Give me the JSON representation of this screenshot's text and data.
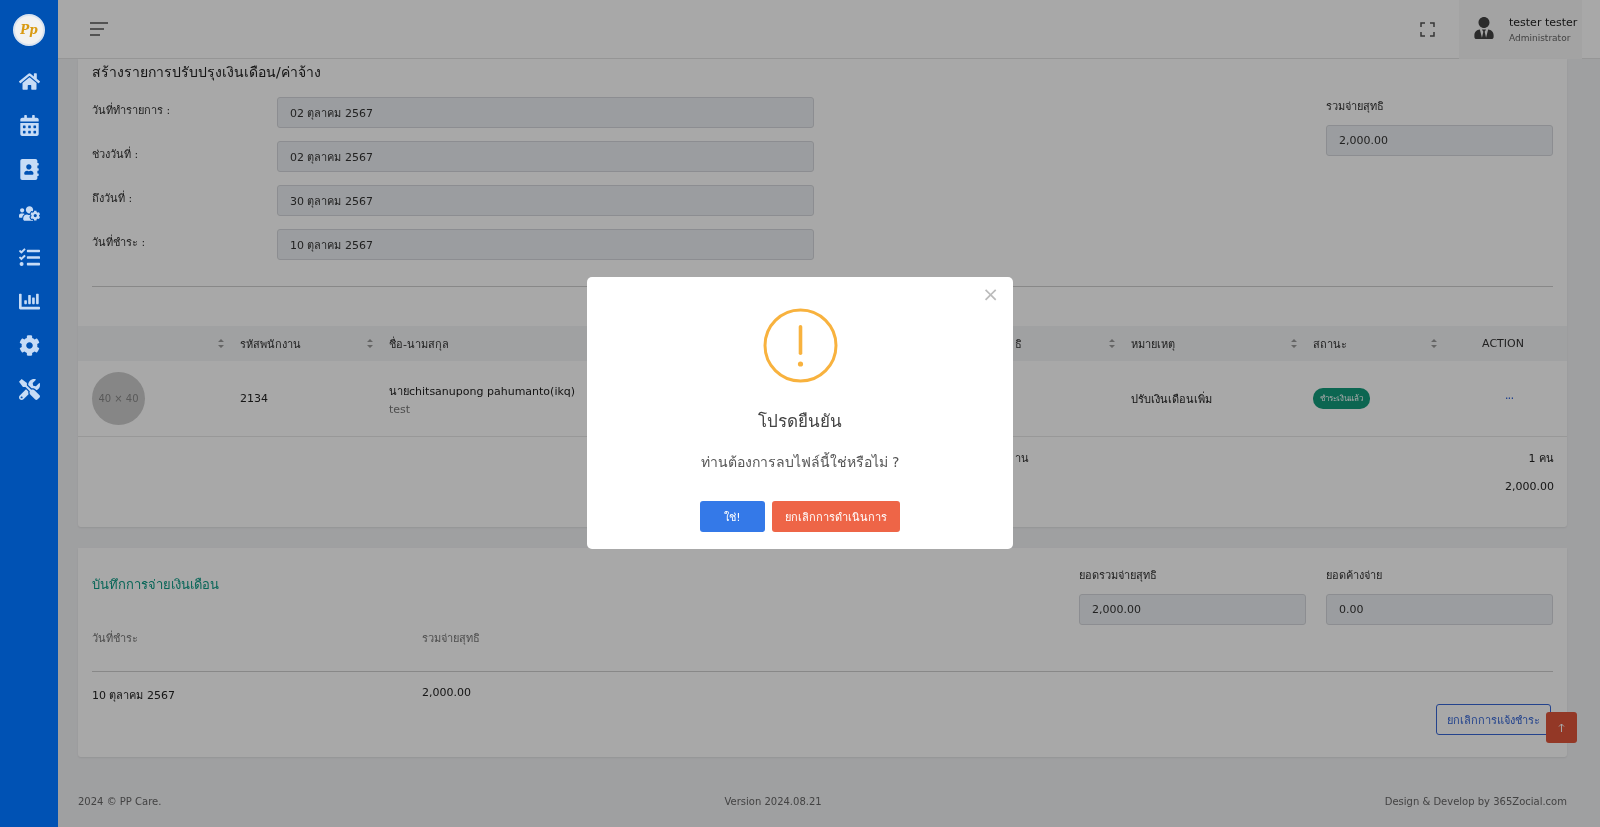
{
  "app": {
    "logo": "Pp"
  },
  "header": {
    "user": {
      "name": "tester tester",
      "role": "Administrator"
    }
  },
  "form": {
    "title": "สร้างรายการปรับปรุงเงินเดือน/ค่าจ้าง",
    "fields": [
      {
        "label": "วันที่ทำรายการ :",
        "value": "02 ตุลาคม 2567"
      },
      {
        "label": "ช่วงวันที่ :",
        "value": "02 ตุลาคม 2567"
      },
      {
        "label": "ถึงวันที่ :",
        "value": "30 ตุลาคม 2567"
      },
      {
        "label": "วันที่ชำระ :",
        "value": "10 ตุลาคม 2567"
      }
    ],
    "total": {
      "label": "รวมจ่ายสุทธิ",
      "value": "2,000.00"
    }
  },
  "table": {
    "columns": [
      {
        "sortable": true
      },
      {
        "label": "รหัสพนักงาน",
        "sortable": true
      },
      {
        "label": "ชื่อ-นามสกุล"
      },
      {
        "label": "ธิ",
        "sortable": true
      },
      {
        "label": "หมายเหตุ",
        "sortable": true
      },
      {
        "label": "สถานะ",
        "sortable": true
      },
      {
        "label": "ACTION",
        "sortable": false
      }
    ],
    "rows": [
      {
        "avatar": "40 × 40",
        "employee_id": "2134",
        "name": "นายchitsanupong pahumanto(ikq)",
        "subtitle": "test",
        "note": "ปรับเงินเดือนเพิ่ม",
        "status": "ชำระเงินแล้ว",
        "action": "···"
      }
    ],
    "summary": [
      {
        "label": "าน",
        "value": "1 คน"
      },
      {
        "value": "2,000.00"
      }
    ]
  },
  "payments": {
    "title": "บันทึกการจ่ายเงินเดือน",
    "totals": [
      {
        "label": "ยอดรวมจ่ายสุทธิ",
        "value": "2,000.00"
      },
      {
        "label": "ยอดค้างจ่าย",
        "value": "0.00"
      }
    ],
    "columns": [
      "วันที่ชำระ",
      "รวมจ่ายสุทธิ"
    ],
    "rows": [
      [
        "10 ตุลาคม 2567",
        "2,000.00"
      ]
    ],
    "cancel_button": "ยกเลิกการแจ้งชำระ"
  },
  "footer": {
    "copyright": "2024 © PP Care.",
    "version": "Version 2024.08.21",
    "credit": "Design & Develop by 365Zocial.com"
  },
  "dialog": {
    "title": "โปรดยืนยัน",
    "message": "ท่านต้องการลบไฟล์นี้ใช่หรือไม่ ?",
    "close": "×",
    "confirm": "ใช่!",
    "cancel": "ยกเลิกการดำเนินการ"
  }
}
